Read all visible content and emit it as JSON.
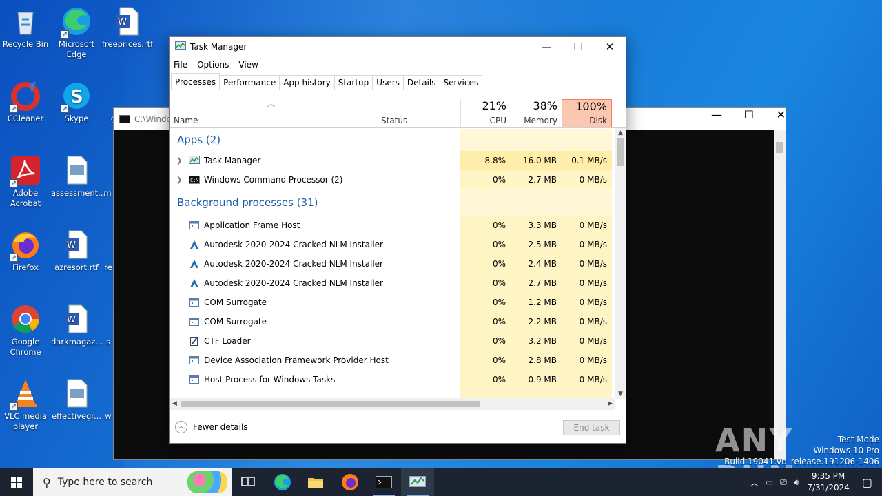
{
  "desktop": {
    "icons": [
      {
        "label": "Recycle Bin",
        "icon": "recycle-bin-icon"
      },
      {
        "label": "Microsoft Edge",
        "icon": "edge-icon"
      },
      {
        "label": "freeprices.rtf",
        "icon": "word-doc-icon"
      },
      {
        "label": "CCleaner",
        "icon": "ccleaner-icon"
      },
      {
        "label": "Skype",
        "icon": "skype-icon"
      },
      {
        "label": "g",
        "icon": "image-file-icon"
      },
      {
        "label": "Adobe Acrobat",
        "icon": "acrobat-icon"
      },
      {
        "label": "assessment...",
        "icon": "image-file-icon"
      },
      {
        "label": "m",
        "icon": "file-icon"
      },
      {
        "label": "Firefox",
        "icon": "firefox-icon"
      },
      {
        "label": "azresort.rtf",
        "icon": "word-doc-icon"
      },
      {
        "label": "re",
        "icon": "file-icon"
      },
      {
        "label": "Google Chrome",
        "icon": "chrome-icon"
      },
      {
        "label": "darkmagaz...",
        "icon": "word-doc-icon"
      },
      {
        "label": "s",
        "icon": "file-icon"
      },
      {
        "label": "VLC media player",
        "icon": "vlc-icon"
      },
      {
        "label": "effectivegr...",
        "icon": "image-file-icon"
      },
      {
        "label": "w",
        "icon": "file-icon"
      }
    ]
  },
  "cmd_window": {
    "title": "C:\\Windo"
  },
  "task_manager": {
    "title": "Task Manager",
    "menu": [
      "File",
      "Options",
      "View"
    ],
    "tabs": [
      "Processes",
      "Performance",
      "App history",
      "Startup",
      "Users",
      "Details",
      "Services"
    ],
    "active_tab": "Processes",
    "columns": {
      "name": "Name",
      "status": "Status",
      "cpu": {
        "percent": "21%",
        "label": "CPU"
      },
      "memory": {
        "percent": "38%",
        "label": "Memory"
      },
      "disk": {
        "percent": "100%",
        "label": "Disk"
      }
    },
    "apps_group": "Apps (2)",
    "apps": [
      {
        "name": "Task Manager",
        "cpu": "8.8%",
        "memory": "16.0 MB",
        "disk": "0.1 MB/s",
        "icon": "task-manager-icon"
      },
      {
        "name": "Windows Command Processor (2)",
        "cpu": "0%",
        "memory": "2.7 MB",
        "disk": "0 MB/s",
        "icon": "cmd-icon"
      }
    ],
    "bg_group": "Background processes (31)",
    "background": [
      {
        "name": "Application Frame Host",
        "cpu": "0%",
        "memory": "3.3 MB",
        "disk": "0 MB/s",
        "icon": "app-window-icon"
      },
      {
        "name": "Autodesk 2020-2024 Cracked NLM Installer",
        "cpu": "0%",
        "memory": "2.5 MB",
        "disk": "0 MB/s",
        "icon": "autodesk-icon"
      },
      {
        "name": "Autodesk 2020-2024 Cracked NLM Installer",
        "cpu": "0%",
        "memory": "2.4 MB",
        "disk": "0 MB/s",
        "icon": "autodesk-icon"
      },
      {
        "name": "Autodesk 2020-2024 Cracked NLM Installer",
        "cpu": "0%",
        "memory": "2.7 MB",
        "disk": "0 MB/s",
        "icon": "autodesk-icon"
      },
      {
        "name": "COM Surrogate",
        "cpu": "0%",
        "memory": "1.2 MB",
        "disk": "0 MB/s",
        "icon": "app-window-icon"
      },
      {
        "name": "COM Surrogate",
        "cpu": "0%",
        "memory": "2.2 MB",
        "disk": "0 MB/s",
        "icon": "app-window-icon"
      },
      {
        "name": "CTF Loader",
        "cpu": "0%",
        "memory": "3.2 MB",
        "disk": "0 MB/s",
        "icon": "ctf-loader-icon"
      },
      {
        "name": "Device Association Framework Provider Host",
        "cpu": "0%",
        "memory": "2.8 MB",
        "disk": "0 MB/s",
        "icon": "app-window-icon"
      },
      {
        "name": "Host Process for Windows Tasks",
        "cpu": "0%",
        "memory": "0.9 MB",
        "disk": "0 MB/s",
        "icon": "app-window-icon"
      }
    ],
    "fewer_details": "Fewer details",
    "end_task": "End task"
  },
  "watermark": {
    "brand": "ANY RUN",
    "test_mode": "Test Mode",
    "os": "Windows 10 Pro",
    "build": "Build 19041.vb_release.191206-1406"
  },
  "taskbar": {
    "search_placeholder": "Type here to search",
    "time": "9:35 PM",
    "date": "7/31/2024"
  },
  "colors": {
    "accent": "#1f5dab",
    "heat_light": "#fff4c4",
    "disk_border": "#f0a090",
    "taskbar": "#1b2430"
  }
}
